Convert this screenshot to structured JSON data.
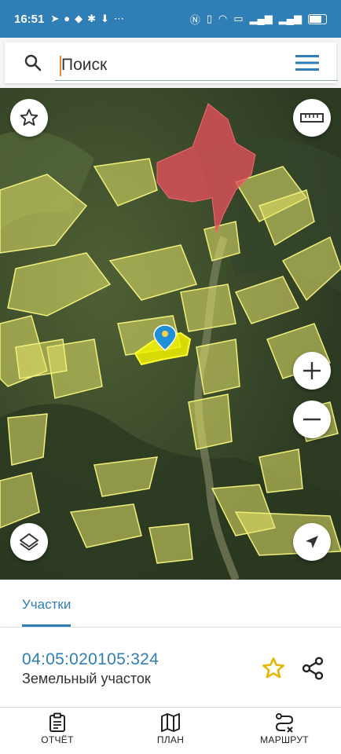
{
  "status_bar": {
    "time": "16:51",
    "notification_icons": [
      "telegram-icon",
      "chat-icon",
      "message-icon",
      "settings-icon",
      "download-icon"
    ],
    "more": "⋯",
    "right_icons": [
      "nfc-icon",
      "vibrate-icon",
      "wifi-icon",
      "volte-icon",
      "signal-icon",
      "signal-icon",
      "battery-icon"
    ]
  },
  "search": {
    "placeholder": "Поиск",
    "value": ""
  },
  "map": {
    "controls": [
      "favorites-star",
      "ruler",
      "zoom-in",
      "zoom-out",
      "layers",
      "locate"
    ],
    "colors": {
      "parcels": "#e3e36a",
      "settlement": "#e0505a",
      "selected": "#f2f200",
      "pin": "#1f8fd6"
    }
  },
  "panel": {
    "tab_label": "Участки",
    "parcel_id": "04:05:020105:324",
    "parcel_type": "Земельный участок",
    "star_color": "#e6b80b"
  },
  "bottom_nav": {
    "report_label": "ОТЧЁТ",
    "plan_label": "ПЛАН",
    "route_label": "МАРШРУТ"
  },
  "colors": {
    "accent": "#2f7fb6"
  }
}
